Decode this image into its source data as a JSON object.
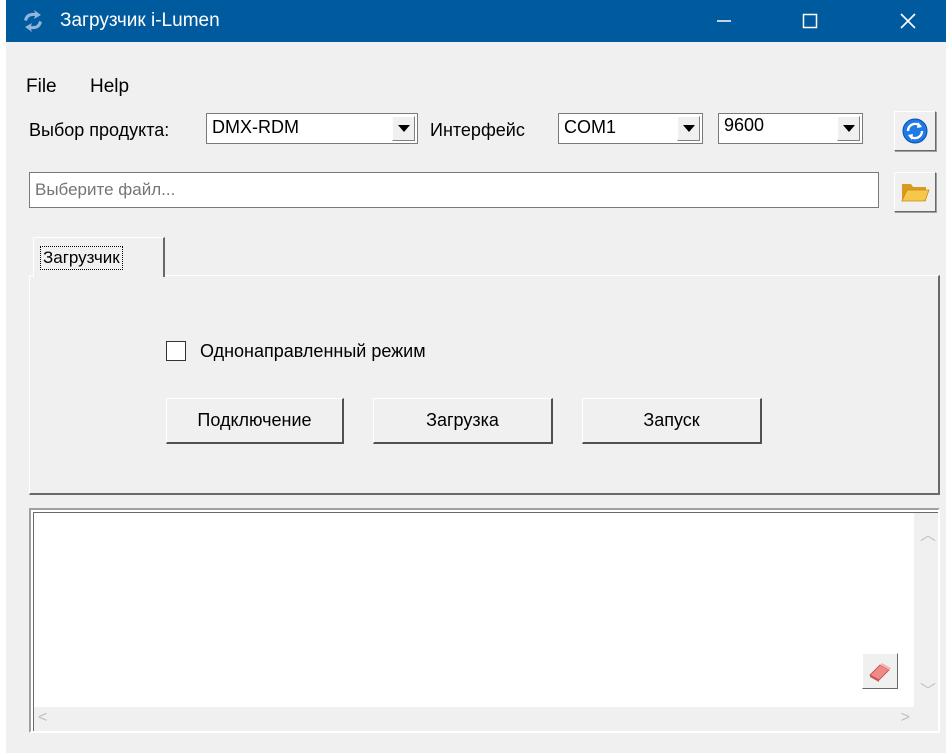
{
  "window": {
    "title": "Загрузчик i-Lumen",
    "minimize_label": "—",
    "maximize_label": "☐",
    "close_label": "✕"
  },
  "menu": {
    "items": [
      "File",
      "Help"
    ]
  },
  "toolbar": {
    "product_label": "Выбор продукта:",
    "product_value": "DMX-RDM",
    "interface_label": "Интерфейс",
    "interface_value": "COM1",
    "baud_value": "9600",
    "refresh_icon": "refresh-icon"
  },
  "file": {
    "placeholder": "Выберите файл...",
    "open_icon": "folder-open-icon"
  },
  "tabs": [
    {
      "label": "Загрузчик"
    }
  ],
  "loader": {
    "checkbox_label": "Однонаправленный режим",
    "checkbox_checked": false,
    "buttons": [
      "Подключение",
      "Загрузка",
      "Запуск"
    ]
  },
  "log": {
    "clear_icon": "eraser-icon"
  }
}
